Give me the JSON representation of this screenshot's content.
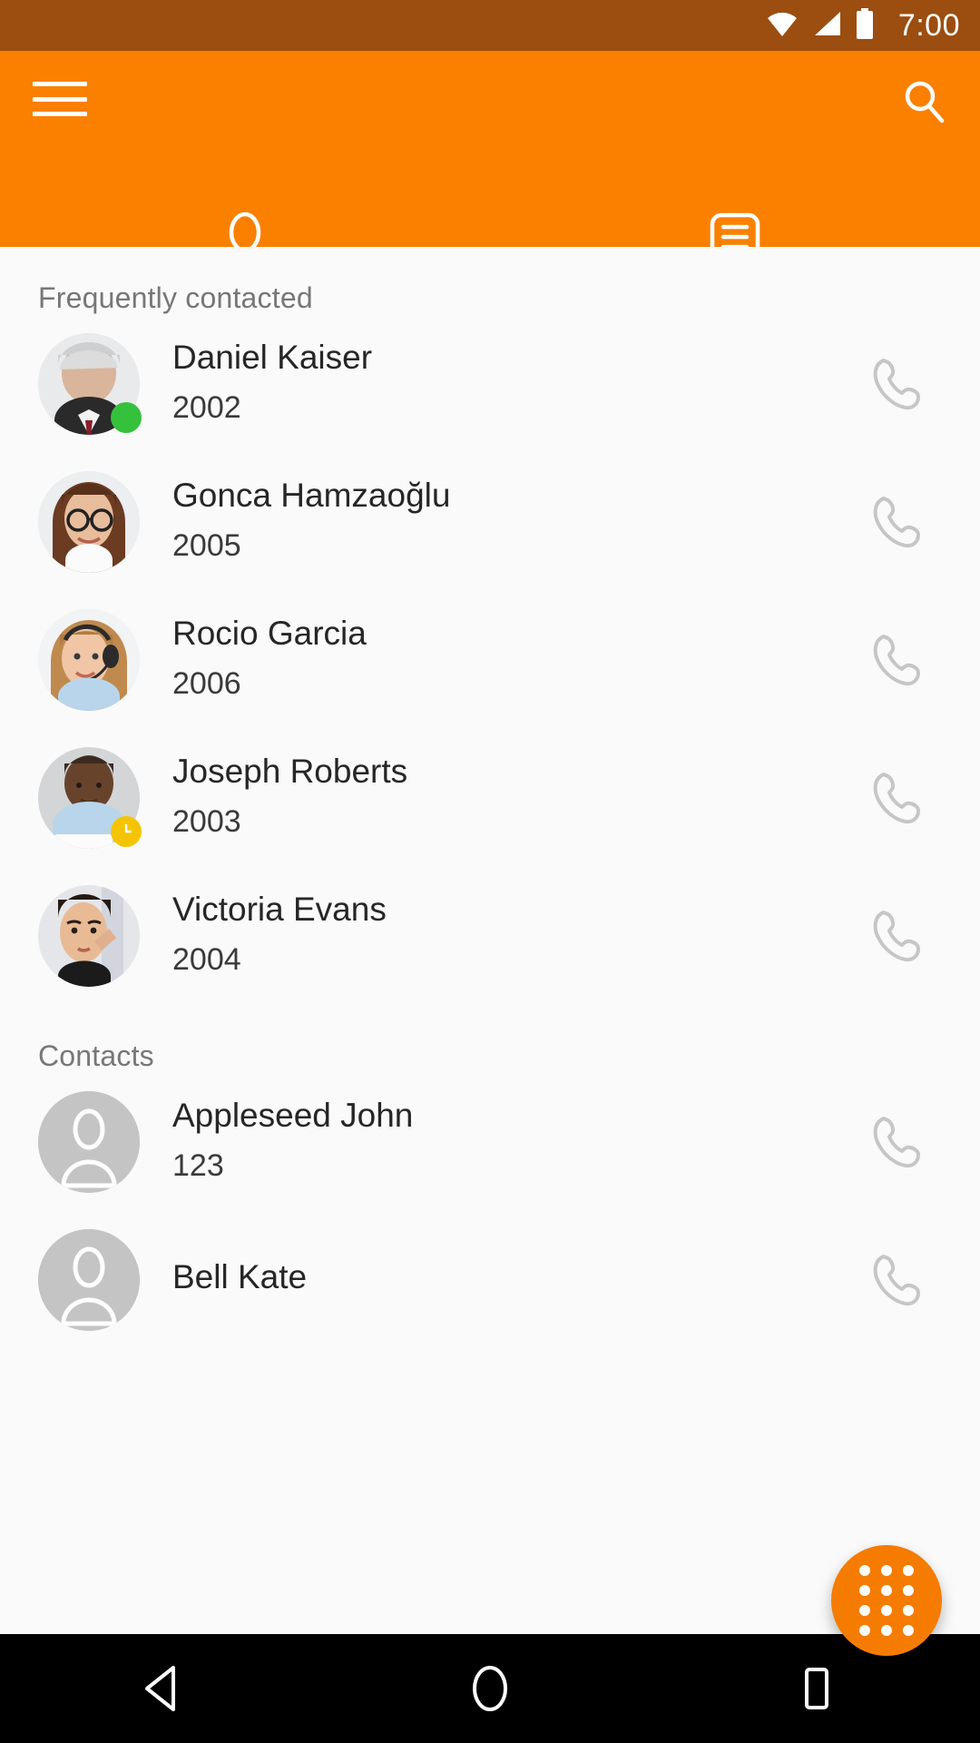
{
  "status_bar": {
    "time": "7:00",
    "icons": [
      "wifi-icon",
      "cellular-signal-icon",
      "battery-icon"
    ]
  },
  "app_bar": {
    "menu_icon": "hamburger-menu-icon",
    "search_icon": "search-icon",
    "background_color": "#fb8000",
    "status_bar_color": "#9c4d10"
  },
  "tabs": [
    {
      "name": "contacts",
      "icon": "person-icon",
      "active": true
    },
    {
      "name": "call-log",
      "icon": "list-document-icon",
      "active": false
    }
  ],
  "sections": [
    {
      "header": "Frequently contacted",
      "contacts": [
        {
          "name": "Daniel Kaiser",
          "extension": "2002",
          "avatar": "photo-man-gray-hair",
          "status": "online",
          "call_icon": "phone-handset-icon"
        },
        {
          "name": "Gonca Hamzaoğlu",
          "extension": "2005",
          "avatar": "photo-woman-glasses",
          "status": "none",
          "call_icon": "phone-handset-icon"
        },
        {
          "name": "Rocio Garcia",
          "extension": "2006",
          "avatar": "photo-woman-headset",
          "status": "none",
          "call_icon": "phone-handset-icon"
        },
        {
          "name": "Joseph Roberts",
          "extension": "2003",
          "avatar": "photo-man-laptop",
          "status": "away",
          "call_icon": "phone-handset-icon"
        },
        {
          "name": "Victoria Evans",
          "extension": "2004",
          "avatar": "photo-woman-phone",
          "status": "none",
          "call_icon": "phone-handset-icon"
        }
      ]
    },
    {
      "header": "Contacts",
      "contacts": [
        {
          "name": "Appleseed John",
          "extension": "123",
          "avatar": "default-person-placeholder",
          "status": "none",
          "call_icon": "phone-handset-icon"
        },
        {
          "name": "Bell Kate",
          "extension": "",
          "avatar": "default-person-placeholder",
          "status": "none",
          "call_icon": "phone-handset-icon"
        }
      ]
    }
  ],
  "fab": {
    "name": "dialpad-button",
    "icon": "dialpad-icon",
    "color": "#f57c00",
    "dot_count": 12
  },
  "nav_bar": {
    "back": "back-triangle-icon",
    "home": "home-circle-icon",
    "recents": "recents-square-icon"
  },
  "colors": {
    "accent": "#fb8000",
    "status_online": "#35c13c",
    "status_away": "#f5c400",
    "background": "#fafafa",
    "text_primary": "#262626",
    "text_secondary": "#777777"
  }
}
